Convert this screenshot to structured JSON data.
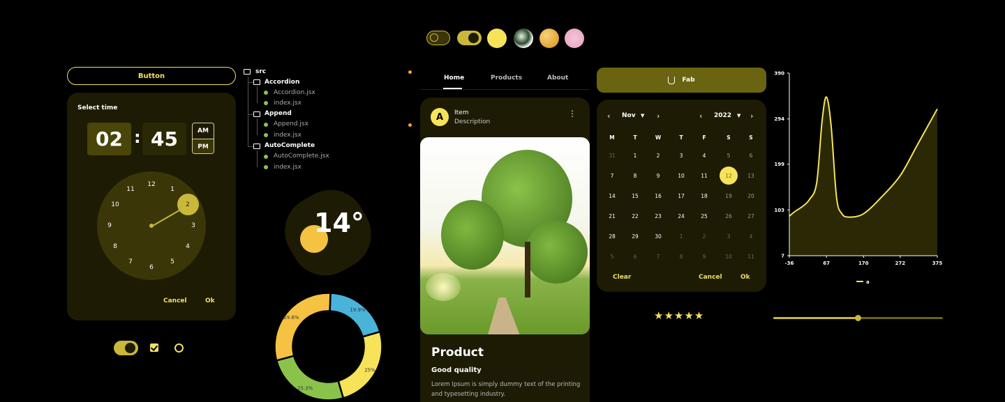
{
  "button": {
    "label": "Button"
  },
  "time_picker": {
    "label": "Select time",
    "hour": "02",
    "minute": "45",
    "am": "AM",
    "pm": "PM",
    "numbers": [
      "12",
      "1",
      "2",
      "3",
      "4",
      "5",
      "6",
      "7",
      "8",
      "9",
      "10",
      "11"
    ],
    "cancel": "Cancel",
    "ok": "Ok"
  },
  "tree": {
    "root": "src",
    "folders": [
      {
        "name": "Accordion",
        "files": [
          "Accordion.jsx",
          "index.jsx"
        ]
      },
      {
        "name": "Append",
        "files": [
          "Append.jsx",
          "index.jsx"
        ]
      },
      {
        "name": "AutoComplete",
        "files": [
          "AutoComplete.jsx",
          "index.jsx"
        ]
      }
    ]
  },
  "weather": {
    "temperature": "14°"
  },
  "donut": {
    "slices": [
      {
        "label": "19.9%",
        "value": 19.9,
        "color": "#4ab3d8"
      },
      {
        "label": "25%",
        "value": 25,
        "color": "#f6e35a"
      },
      {
        "label": "25.3%",
        "value": 25.3,
        "color": "#8bc34a"
      },
      {
        "label": "29.8%",
        "value": 29.8,
        "color": "#f5c242"
      }
    ]
  },
  "tabs": {
    "home": "Home",
    "products": "Products",
    "about": "About"
  },
  "card": {
    "avatar": "A",
    "title": "Item",
    "subtitle": "Description",
    "product_title": "Product",
    "product_subtitle": "Good quality",
    "product_text": "Lorem Ipsum is simply dummy text of the printing and typesetting industry."
  },
  "fab": {
    "label": "Fab"
  },
  "calendar": {
    "month": "Nov",
    "year": "2022",
    "weekdays": [
      "M",
      "T",
      "W",
      "T",
      "F",
      "S",
      "S"
    ],
    "days": [
      "31",
      "1",
      "2",
      "3",
      "4",
      "5",
      "6",
      "7",
      "8",
      "9",
      "10",
      "11",
      "12",
      "13",
      "14",
      "15",
      "16",
      "17",
      "18",
      "19",
      "20",
      "21",
      "22",
      "23",
      "24",
      "25",
      "26",
      "27",
      "28",
      "29",
      "30",
      "1",
      "2",
      "3",
      "4",
      "5",
      "6",
      "7",
      "8",
      "9",
      "10",
      "11"
    ],
    "selected": "12",
    "clear": "Clear",
    "cancel": "Cancel",
    "ok": "Ok"
  },
  "rating": {
    "value": 5,
    "max": 5,
    "stars": "★★★★★"
  },
  "slider": {
    "value": 0.5
  },
  "colors": {
    "accent": "#f2e160",
    "panel": "#1d1b03",
    "dark_accent": "#6a6410"
  },
  "chart_data": {
    "type": "area",
    "series": [
      {
        "name": "a",
        "x": [
          -36,
          -20,
          0,
          20,
          40,
          55,
          67,
          80,
          95,
          110,
          130,
          170,
          220,
          272,
          320,
          375
        ],
        "y": [
          90,
          100,
          110,
          125,
          160,
          290,
          340,
          280,
          130,
          95,
          88,
          95,
          130,
          175,
          240,
          315
        ]
      }
    ],
    "x_ticks": [
      "-36",
      "67",
      "170",
      "272",
      "375"
    ],
    "y_ticks": [
      "7",
      "103",
      "199",
      "294",
      "390"
    ],
    "xlim": [
      -36,
      375
    ],
    "ylim": [
      7,
      390
    ],
    "legend": "a"
  }
}
